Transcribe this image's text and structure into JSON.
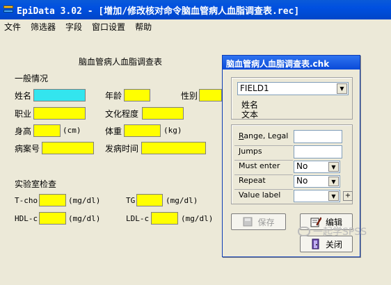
{
  "window": {
    "title": "EpiData 3.02 - [增加/修改核对命令脑血管病人血脂调查表.rec]"
  },
  "menu": {
    "items": [
      "文件",
      "筛选器",
      "字段",
      "窗口设置",
      "帮助"
    ]
  },
  "form": {
    "title": "脑血管病人血脂调查表",
    "section1": "一般情况",
    "name_label": "姓名",
    "age_label": "年龄",
    "gender_label": "性别",
    "occupation_label": "职业",
    "education_label": "文化程度",
    "height_label": "身高",
    "height_unit": "(cm)",
    "weight_label": "体重",
    "weight_unit": "(kg)",
    "caseno_label": "病案号",
    "onset_label": "发病时间",
    "section2": "实验室检查",
    "tcho_label": "T-cho",
    "tcho_unit": "(mg/dl)",
    "tg_label": "TG",
    "tg_unit": "(mg/dl)",
    "hdl_label": "HDL-c",
    "hdl_unit": "(mg/dl)",
    "ldl_label": "LDL-c",
    "ldl_unit": "(mg/dl)"
  },
  "chk": {
    "title": "脑血管病人血脂调查表.chk",
    "field_select": "FIELD1",
    "field_label": "姓名",
    "field_type": "文本",
    "rows": {
      "range_legal": "Range, Legal",
      "jumps": "Jumps",
      "must_enter": "Must enter",
      "must_enter_value": "No",
      "repeat": "Repeat",
      "repeat_value": "No",
      "value_label": "Value label",
      "value_label_value": ""
    },
    "buttons": {
      "save": "保存",
      "edit": "编辑",
      "close": "关闭",
      "plus": "+"
    }
  },
  "watermark": "一起学SPSS",
  "colors": {
    "title_bar": "#0050e0",
    "field_yellow": "#ffff00",
    "field_active": "#33e5ee"
  }
}
